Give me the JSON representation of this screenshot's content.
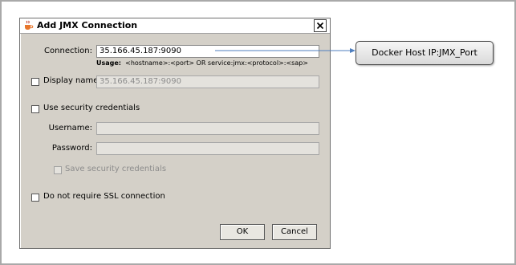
{
  "dialog": {
    "title": "Add JMX Connection",
    "connection": {
      "label": "Connection:",
      "value": "35.166.45.187:9090",
      "usage_label": "Usage:",
      "usage_text": "<hostname>:<port> OR service:jmx:<protocol>:<sap>"
    },
    "display_name": {
      "label": "Display name:",
      "value": "35.166.45.187:9090",
      "checked": false
    },
    "security": {
      "label": "Use security credentials",
      "checked": false,
      "username_label": "Username:",
      "username_value": "",
      "password_label": "Password:",
      "password_value": "",
      "save_label": "Save security credentials"
    },
    "ssl": {
      "label": "Do not require SSL connection",
      "checked": false
    },
    "buttons": {
      "ok": "OK",
      "cancel": "Cancel"
    }
  },
  "annotation": {
    "callout_text": "Docker Host IP:JMX_Port"
  },
  "colors": {
    "arrow": "#4f7fbf",
    "dialog_bg": "#d4d0c8"
  },
  "icons": {
    "app": "java-coffee-icon",
    "close": "close-icon"
  }
}
